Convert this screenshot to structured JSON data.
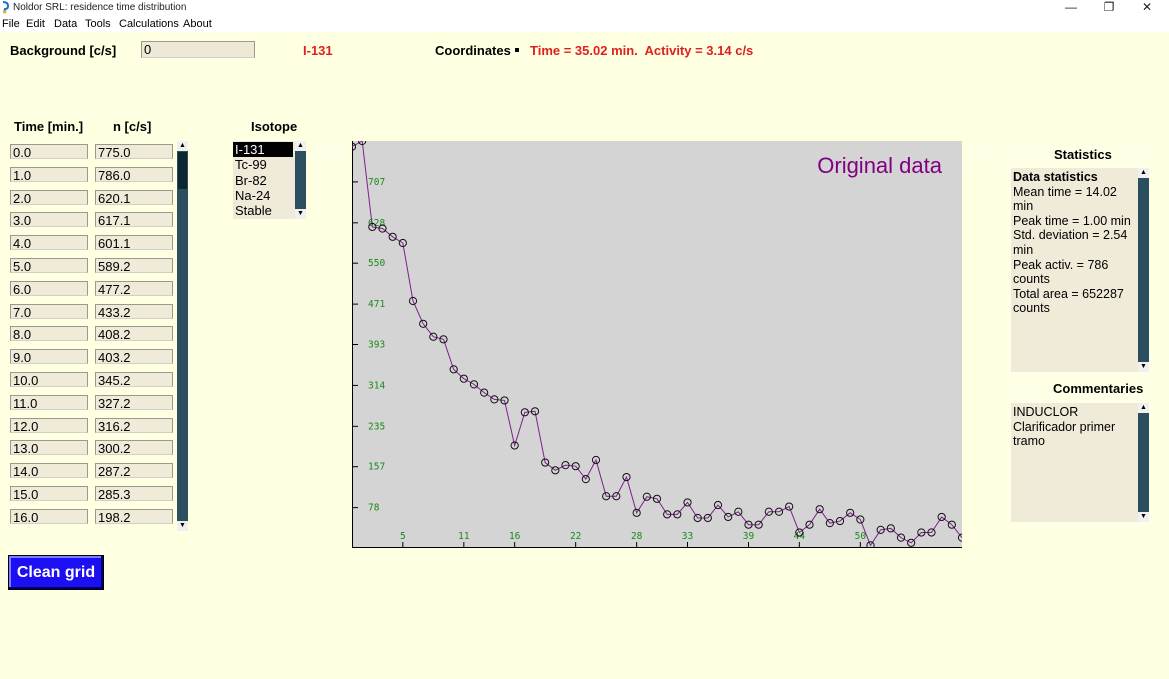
{
  "window": {
    "title": "Noldor SRL: residence time distribution",
    "minimize_glyph": "—",
    "maximize_glyph": "❐",
    "close_glyph": "✕"
  },
  "menu": [
    "File",
    "Edit",
    "Data",
    "Tools",
    "Calculations",
    "About"
  ],
  "header": {
    "background_label": "Background [c/s]",
    "background_value": "0",
    "isotope_current": "I-131",
    "coordinates_label": "Coordinates",
    "coordinates_value": "Time = 35.02 min.  Activity = 3.14 c/s"
  },
  "grid": {
    "col_time_label": "Time [min.]",
    "col_n_label": "n [c/s]",
    "times": [
      "0.0",
      "1.0",
      "2.0",
      "3.0",
      "4.0",
      "5.0",
      "6.0",
      "7.0",
      "8.0",
      "9.0",
      "10.0",
      "11.0",
      "12.0",
      "13.0",
      "14.0",
      "15.0",
      "16.0"
    ],
    "counts": [
      "775.0",
      "786.0",
      "620.1",
      "617.1",
      "601.1",
      "589.2",
      "477.2",
      "433.2",
      "408.2",
      "403.2",
      "345.2",
      "327.2",
      "316.2",
      "300.2",
      "287.2",
      "285.3",
      "198.2"
    ]
  },
  "isotope": {
    "label": "Isotope",
    "options": [
      "I-131",
      "Tc-99",
      "Br-82",
      "Na-24",
      "Stable"
    ],
    "selected": "I-131"
  },
  "chart_data": {
    "type": "line",
    "title": "Original data",
    "xlim": [
      0,
      60
    ],
    "ylim": [
      0,
      786
    ],
    "x_ticks": [
      5,
      11,
      16,
      22,
      28,
      33,
      39,
      44,
      50
    ],
    "y_ticks": [
      78,
      157,
      235,
      314,
      393,
      471,
      550,
      628,
      707
    ],
    "x": [
      0,
      1,
      2,
      3,
      4,
      5,
      6,
      7,
      8,
      9,
      10,
      11,
      12,
      13,
      14,
      15,
      16,
      17,
      18,
      19,
      20,
      21,
      22,
      23,
      24,
      25,
      26,
      27,
      28,
      29,
      30,
      31,
      32,
      33,
      34,
      35,
      36,
      37,
      38,
      39,
      40,
      41,
      42,
      43,
      44,
      45,
      46,
      47,
      48,
      49,
      50,
      51,
      52,
      53,
      54,
      55,
      56,
      57,
      58,
      59,
      60
    ],
    "y": [
      775,
      786,
      620,
      617,
      601,
      589,
      477,
      433,
      408,
      403,
      345,
      327,
      316,
      300,
      287,
      285,
      198,
      262,
      264,
      165,
      150,
      160,
      158,
      133,
      170,
      100,
      100,
      137,
      68,
      99,
      95,
      65,
      65,
      88,
      58,
      58,
      83,
      60,
      70,
      45,
      45,
      70,
      70,
      80,
      30,
      45,
      75,
      48,
      52,
      68,
      55,
      5,
      35,
      38,
      20,
      10,
      30,
      30,
      60,
      45,
      20
    ]
  },
  "statistics": {
    "title": "Statistics",
    "heading": "Data statistics",
    "lines": [
      "Mean time = 14.02",
      "min",
      "Peak time = 1.00 min",
      "Std. deviation = 2.54",
      "min",
      "Peak activ. = 786",
      "counts",
      "Total area = 652287",
      "counts"
    ]
  },
  "commentaries": {
    "title": "Commentaries",
    "lines": [
      "INDUCLOR",
      "Clarificador primer",
      "tramo"
    ]
  },
  "buttons": {
    "clean_grid": "Clean grid"
  }
}
